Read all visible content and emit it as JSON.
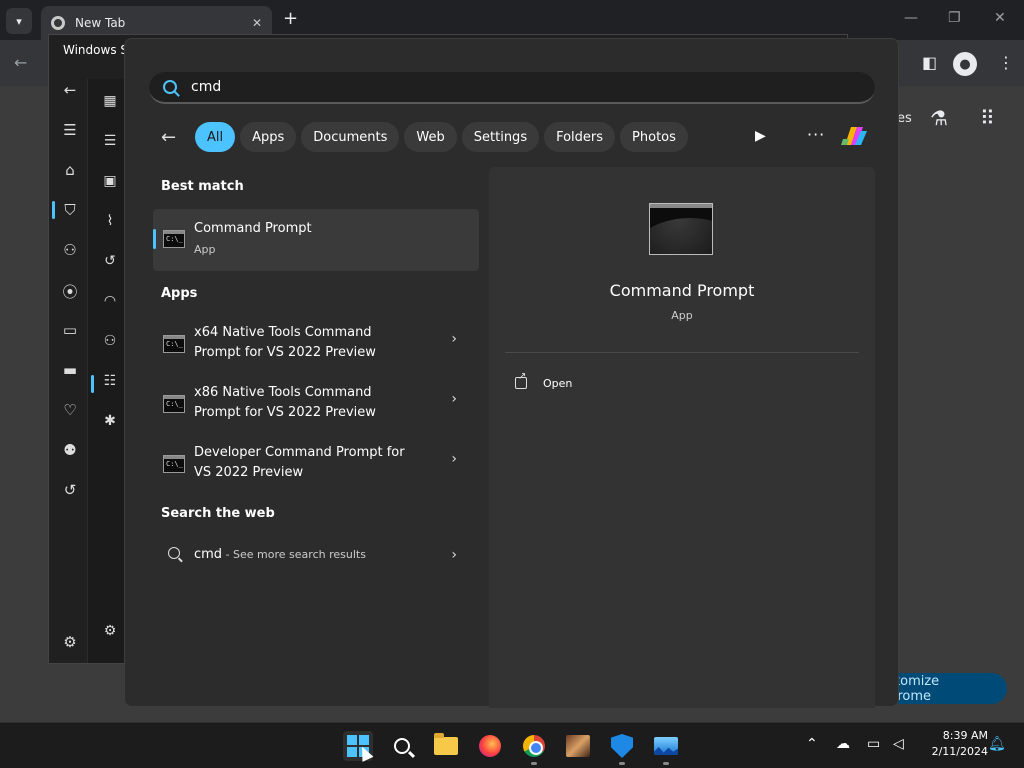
{
  "chrome": {
    "tab_title": "New Tab",
    "partial_button_text": "es",
    "customize_label": "ustomize Chrome"
  },
  "winsec": {
    "title": "Windows Security"
  },
  "search": {
    "query": "cmd",
    "filters": [
      "All",
      "Apps",
      "Documents",
      "Web",
      "Settings",
      "Folders",
      "Photos"
    ],
    "active_filter": "All"
  },
  "sections": {
    "best_match": "Best match",
    "apps": "Apps",
    "search_web": "Search the web"
  },
  "best_match": {
    "title": "Command Prompt",
    "subtitle": "App"
  },
  "apps": [
    {
      "line1": "x64 Native Tools Command",
      "line2": "Prompt for VS 2022 Preview"
    },
    {
      "line1": "x86 Native Tools Command",
      "line2": "Prompt for VS 2022 Preview"
    },
    {
      "line1": "Developer Command Prompt for",
      "line2": "VS 2022 Preview"
    }
  ],
  "web_result": {
    "query": "cmd",
    "hint": " - See more search results"
  },
  "preview": {
    "title": "Command Prompt",
    "subtitle": "App",
    "open_label": "Open"
  },
  "tray": {
    "time": "8:39 AM",
    "date": "2/11/2024"
  },
  "colors": {
    "accent": "#4cc2ff",
    "panel_bg": "#2c2c2c",
    "customize_bg": "#004a77"
  }
}
